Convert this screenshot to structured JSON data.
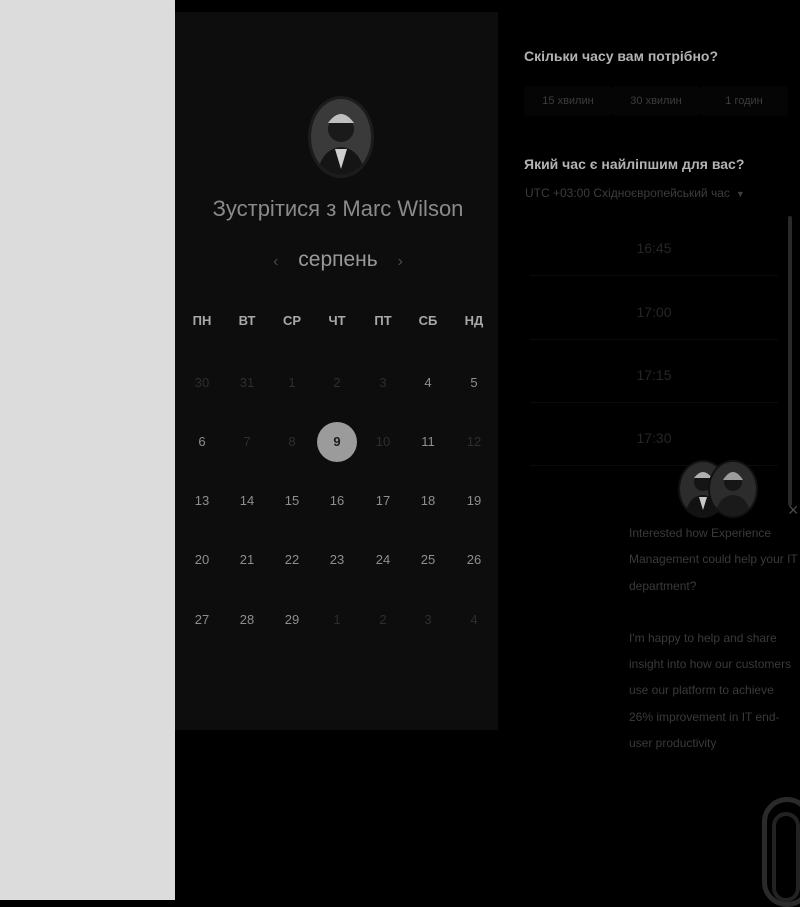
{
  "calendar": {
    "title": "Зустрітися з Marc Wilson",
    "month": "серпень",
    "prev_arrow": "‹",
    "next_arrow": "›",
    "weekdays": [
      "ПН",
      "ВТ",
      "СР",
      "ЧТ",
      "ПТ",
      "СБ",
      "НД"
    ],
    "weeks": [
      [
        {
          "d": "30",
          "dim": true
        },
        {
          "d": "31",
          "dim": true
        },
        {
          "d": "1",
          "dim": true
        },
        {
          "d": "2",
          "dim": true
        },
        {
          "d": "3",
          "dim": true
        },
        {
          "d": "4"
        },
        {
          "d": "5"
        }
      ],
      [
        {
          "d": "6"
        },
        {
          "d": "7",
          "dim": true
        },
        {
          "d": "8",
          "dim": true
        },
        {
          "d": "9",
          "selected": true
        },
        {
          "d": "10",
          "dim": true
        },
        {
          "d": "11"
        },
        {
          "d": "12",
          "dim": true
        }
      ],
      [
        {
          "d": "13"
        },
        {
          "d": "14"
        },
        {
          "d": "15"
        },
        {
          "d": "16"
        },
        {
          "d": "17"
        },
        {
          "d": "18"
        },
        {
          "d": "19"
        }
      ],
      [
        {
          "d": "20"
        },
        {
          "d": "21"
        },
        {
          "d": "22"
        },
        {
          "d": "23"
        },
        {
          "d": "24"
        },
        {
          "d": "25"
        },
        {
          "d": "26"
        }
      ],
      [
        {
          "d": "27"
        },
        {
          "d": "28"
        },
        {
          "d": "29"
        },
        {
          "d": "1",
          "dim": true
        },
        {
          "d": "2",
          "dim": true
        },
        {
          "d": "3",
          "dim": true
        },
        {
          "d": "4",
          "dim": true
        }
      ]
    ]
  },
  "booking": {
    "duration_question": "Скільки часу вам потрібно?",
    "durations": [
      "15 хвилин",
      "30 хвилин",
      "1 годин"
    ],
    "time_question": "Який час є найліпшим для вас?",
    "timezone": "UTC +03:00 Східноєвропейський час",
    "slots": [
      "16:45",
      "17:00",
      "17:15",
      "17:30"
    ]
  },
  "chat": {
    "close": "×",
    "message_1": "Interested how Experience Management could help your IT department?",
    "message_2": "I'm happy to help and share insight into how our customers use our platform to achieve 26% improvement in IT end-user productivity"
  },
  "colors": {
    "background": "#000000",
    "left_strip": "#dcdcdc",
    "panel": "#0d0d0d",
    "selected_day": "#9b9b9b"
  }
}
